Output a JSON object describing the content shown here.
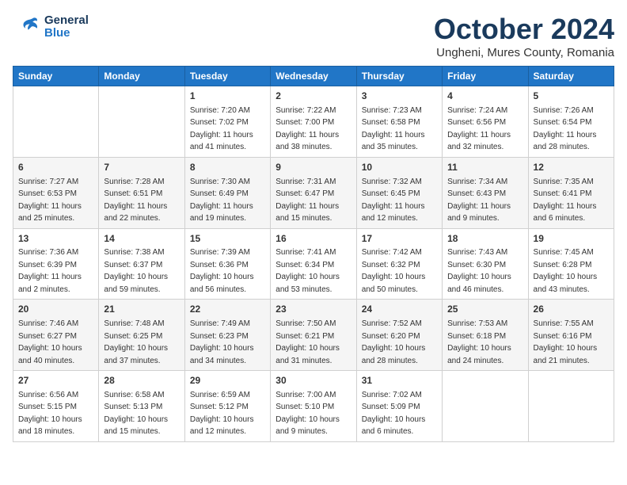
{
  "header": {
    "logo_general": "General",
    "logo_blue": "Blue",
    "month": "October 2024",
    "location": "Ungheni, Mures County, Romania"
  },
  "days_of_week": [
    "Sunday",
    "Monday",
    "Tuesday",
    "Wednesday",
    "Thursday",
    "Friday",
    "Saturday"
  ],
  "weeks": [
    [
      {
        "day": "",
        "info": ""
      },
      {
        "day": "",
        "info": ""
      },
      {
        "day": "1",
        "info": "Sunrise: 7:20 AM\nSunset: 7:02 PM\nDaylight: 11 hours and 41 minutes."
      },
      {
        "day": "2",
        "info": "Sunrise: 7:22 AM\nSunset: 7:00 PM\nDaylight: 11 hours and 38 minutes."
      },
      {
        "day": "3",
        "info": "Sunrise: 7:23 AM\nSunset: 6:58 PM\nDaylight: 11 hours and 35 minutes."
      },
      {
        "day": "4",
        "info": "Sunrise: 7:24 AM\nSunset: 6:56 PM\nDaylight: 11 hours and 32 minutes."
      },
      {
        "day": "5",
        "info": "Sunrise: 7:26 AM\nSunset: 6:54 PM\nDaylight: 11 hours and 28 minutes."
      }
    ],
    [
      {
        "day": "6",
        "info": "Sunrise: 7:27 AM\nSunset: 6:53 PM\nDaylight: 11 hours and 25 minutes."
      },
      {
        "day": "7",
        "info": "Sunrise: 7:28 AM\nSunset: 6:51 PM\nDaylight: 11 hours and 22 minutes."
      },
      {
        "day": "8",
        "info": "Sunrise: 7:30 AM\nSunset: 6:49 PM\nDaylight: 11 hours and 19 minutes."
      },
      {
        "day": "9",
        "info": "Sunrise: 7:31 AM\nSunset: 6:47 PM\nDaylight: 11 hours and 15 minutes."
      },
      {
        "day": "10",
        "info": "Sunrise: 7:32 AM\nSunset: 6:45 PM\nDaylight: 11 hours and 12 minutes."
      },
      {
        "day": "11",
        "info": "Sunrise: 7:34 AM\nSunset: 6:43 PM\nDaylight: 11 hours and 9 minutes."
      },
      {
        "day": "12",
        "info": "Sunrise: 7:35 AM\nSunset: 6:41 PM\nDaylight: 11 hours and 6 minutes."
      }
    ],
    [
      {
        "day": "13",
        "info": "Sunrise: 7:36 AM\nSunset: 6:39 PM\nDaylight: 11 hours and 2 minutes."
      },
      {
        "day": "14",
        "info": "Sunrise: 7:38 AM\nSunset: 6:37 PM\nDaylight: 10 hours and 59 minutes."
      },
      {
        "day": "15",
        "info": "Sunrise: 7:39 AM\nSunset: 6:36 PM\nDaylight: 10 hours and 56 minutes."
      },
      {
        "day": "16",
        "info": "Sunrise: 7:41 AM\nSunset: 6:34 PM\nDaylight: 10 hours and 53 minutes."
      },
      {
        "day": "17",
        "info": "Sunrise: 7:42 AM\nSunset: 6:32 PM\nDaylight: 10 hours and 50 minutes."
      },
      {
        "day": "18",
        "info": "Sunrise: 7:43 AM\nSunset: 6:30 PM\nDaylight: 10 hours and 46 minutes."
      },
      {
        "day": "19",
        "info": "Sunrise: 7:45 AM\nSunset: 6:28 PM\nDaylight: 10 hours and 43 minutes."
      }
    ],
    [
      {
        "day": "20",
        "info": "Sunrise: 7:46 AM\nSunset: 6:27 PM\nDaylight: 10 hours and 40 minutes."
      },
      {
        "day": "21",
        "info": "Sunrise: 7:48 AM\nSunset: 6:25 PM\nDaylight: 10 hours and 37 minutes."
      },
      {
        "day": "22",
        "info": "Sunrise: 7:49 AM\nSunset: 6:23 PM\nDaylight: 10 hours and 34 minutes."
      },
      {
        "day": "23",
        "info": "Sunrise: 7:50 AM\nSunset: 6:21 PM\nDaylight: 10 hours and 31 minutes."
      },
      {
        "day": "24",
        "info": "Sunrise: 7:52 AM\nSunset: 6:20 PM\nDaylight: 10 hours and 28 minutes."
      },
      {
        "day": "25",
        "info": "Sunrise: 7:53 AM\nSunset: 6:18 PM\nDaylight: 10 hours and 24 minutes."
      },
      {
        "day": "26",
        "info": "Sunrise: 7:55 AM\nSunset: 6:16 PM\nDaylight: 10 hours and 21 minutes."
      }
    ],
    [
      {
        "day": "27",
        "info": "Sunrise: 6:56 AM\nSunset: 5:15 PM\nDaylight: 10 hours and 18 minutes."
      },
      {
        "day": "28",
        "info": "Sunrise: 6:58 AM\nSunset: 5:13 PM\nDaylight: 10 hours and 15 minutes."
      },
      {
        "day": "29",
        "info": "Sunrise: 6:59 AM\nSunset: 5:12 PM\nDaylight: 10 hours and 12 minutes."
      },
      {
        "day": "30",
        "info": "Sunrise: 7:00 AM\nSunset: 5:10 PM\nDaylight: 10 hours and 9 minutes."
      },
      {
        "day": "31",
        "info": "Sunrise: 7:02 AM\nSunset: 5:09 PM\nDaylight: 10 hours and 6 minutes."
      },
      {
        "day": "",
        "info": ""
      },
      {
        "day": "",
        "info": ""
      }
    ]
  ]
}
